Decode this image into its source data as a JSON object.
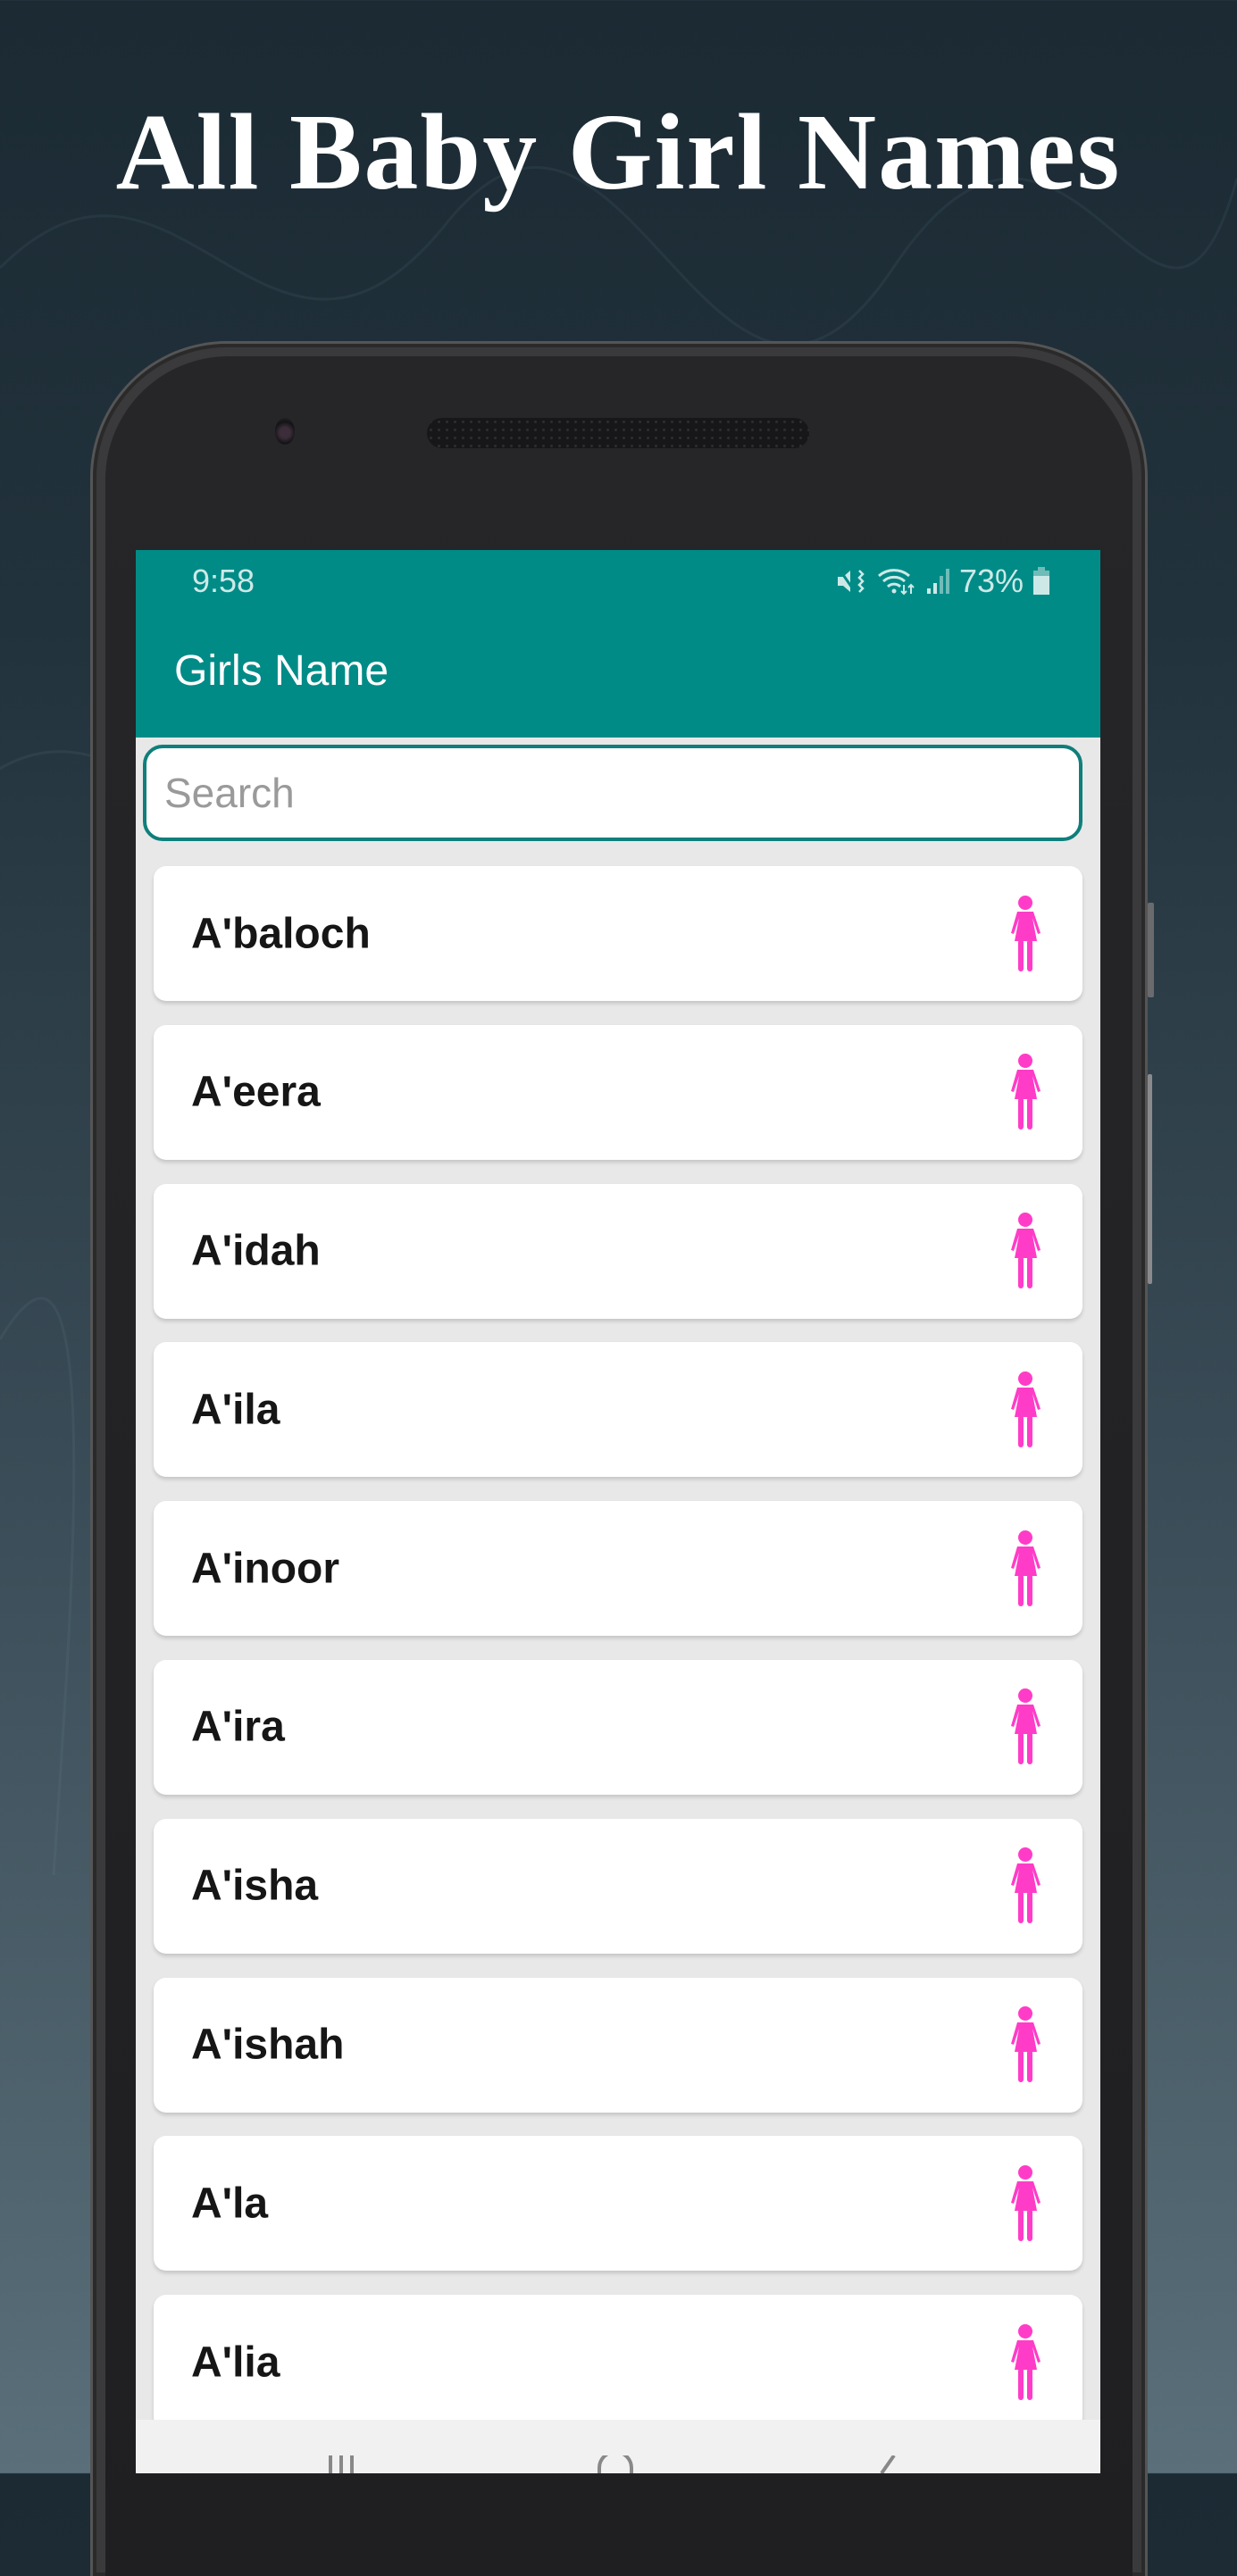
{
  "promo": {
    "headline": "All Baby Girl Names"
  },
  "status_bar": {
    "time": "9:58",
    "battery": "73%",
    "icons": [
      "mute-vibrate-icon",
      "wifi-icon",
      "signal-icon",
      "battery-icon"
    ]
  },
  "app_bar": {
    "title": "Girls Name",
    "color": "#008b87"
  },
  "search": {
    "placeholder": "Search",
    "value": ""
  },
  "names": [
    {
      "name": "A'baloch",
      "icon": "female-icon"
    },
    {
      "name": "A'eera",
      "icon": "female-icon"
    },
    {
      "name": "A'idah",
      "icon": "female-icon"
    },
    {
      "name": "A'ila",
      "icon": "female-icon"
    },
    {
      "name": "A'inoor",
      "icon": "female-icon"
    },
    {
      "name": "A'ira",
      "icon": "female-icon"
    },
    {
      "name": "A'isha",
      "icon": "female-icon"
    },
    {
      "name": "A'ishah",
      "icon": "female-icon"
    },
    {
      "name": "A'la",
      "icon": "female-icon"
    },
    {
      "name": "A'lia",
      "icon": "female-icon"
    }
  ],
  "colors": {
    "female_icon": "#ff3cc7",
    "name_text": "#161616"
  },
  "nav_bar": {
    "buttons": [
      "recents-button",
      "home-button",
      "back-button"
    ]
  }
}
